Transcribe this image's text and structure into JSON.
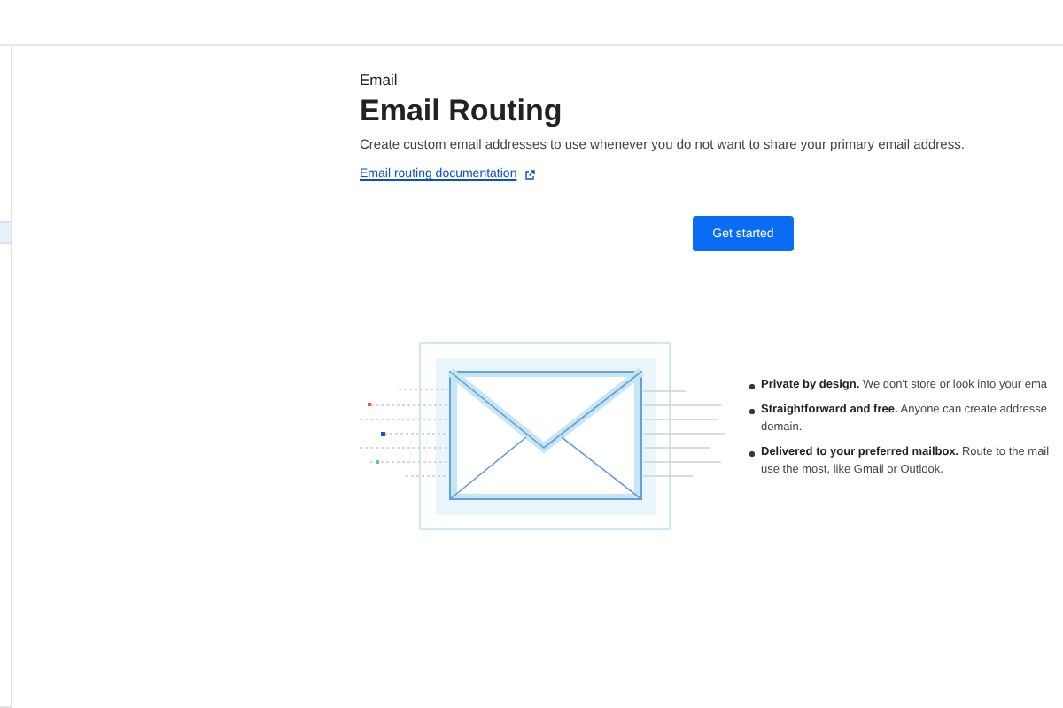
{
  "header": {
    "eyebrow": "Email",
    "title": "Email Routing",
    "description": "Create custom email addresses to use whenever you do not want to share your primary email address.",
    "link": "Email routing documentation"
  },
  "button": "Get started",
  "features": [
    {
      "title": "Private by design.",
      "lines": [
        "We don't store or look into your ema"
      ]
    },
    {
      "title": "Straightforward and free.",
      "lines": [
        "Anyone can create addresse",
        "domain."
      ]
    },
    {
      "title": "Delivered to your preferred mailbox.",
      "lines": [
        "Route to the mail",
        "use the most, like Gmail or Outlook."
      ]
    }
  ]
}
